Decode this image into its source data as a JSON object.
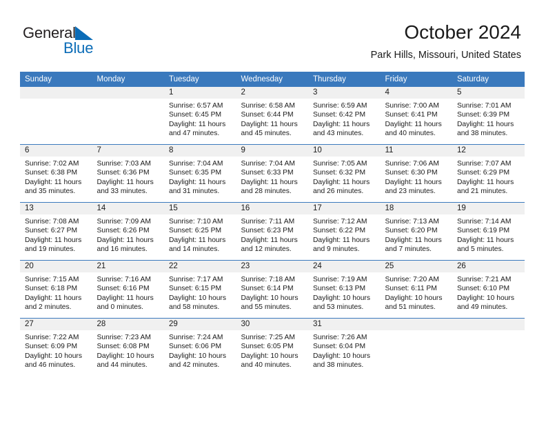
{
  "brand": {
    "name_part1": "General",
    "name_part2": "Blue",
    "triangle_color": "#0b6cb7"
  },
  "header": {
    "title": "October 2024",
    "subtitle": "Park Hills, Missouri, United States"
  },
  "theme": {
    "header_blue": "#3a79bd",
    "band_gray": "#f0f0f0",
    "text": "#1a1a1a"
  },
  "weekdays": [
    "Sunday",
    "Monday",
    "Tuesday",
    "Wednesday",
    "Thursday",
    "Friday",
    "Saturday"
  ],
  "labels": {
    "sunrise_prefix": "Sunrise:",
    "sunset_prefix": "Sunset:",
    "daylight_prefix": "Daylight:"
  },
  "weeks": [
    [
      {
        "day": "",
        "sunrise": "",
        "sunset": "",
        "daylight": ""
      },
      {
        "day": "",
        "sunrise": "",
        "sunset": "",
        "daylight": ""
      },
      {
        "day": "1",
        "sunrise": "Sunrise: 6:57 AM",
        "sunset": "Sunset: 6:45 PM",
        "daylight": "Daylight: 11 hours and 47 minutes."
      },
      {
        "day": "2",
        "sunrise": "Sunrise: 6:58 AM",
        "sunset": "Sunset: 6:44 PM",
        "daylight": "Daylight: 11 hours and 45 minutes."
      },
      {
        "day": "3",
        "sunrise": "Sunrise: 6:59 AM",
        "sunset": "Sunset: 6:42 PM",
        "daylight": "Daylight: 11 hours and 43 minutes."
      },
      {
        "day": "4",
        "sunrise": "Sunrise: 7:00 AM",
        "sunset": "Sunset: 6:41 PM",
        "daylight": "Daylight: 11 hours and 40 minutes."
      },
      {
        "day": "5",
        "sunrise": "Sunrise: 7:01 AM",
        "sunset": "Sunset: 6:39 PM",
        "daylight": "Daylight: 11 hours and 38 minutes."
      }
    ],
    [
      {
        "day": "6",
        "sunrise": "Sunrise: 7:02 AM",
        "sunset": "Sunset: 6:38 PM",
        "daylight": "Daylight: 11 hours and 35 minutes."
      },
      {
        "day": "7",
        "sunrise": "Sunrise: 7:03 AM",
        "sunset": "Sunset: 6:36 PM",
        "daylight": "Daylight: 11 hours and 33 minutes."
      },
      {
        "day": "8",
        "sunrise": "Sunrise: 7:04 AM",
        "sunset": "Sunset: 6:35 PM",
        "daylight": "Daylight: 11 hours and 31 minutes."
      },
      {
        "day": "9",
        "sunrise": "Sunrise: 7:04 AM",
        "sunset": "Sunset: 6:33 PM",
        "daylight": "Daylight: 11 hours and 28 minutes."
      },
      {
        "day": "10",
        "sunrise": "Sunrise: 7:05 AM",
        "sunset": "Sunset: 6:32 PM",
        "daylight": "Daylight: 11 hours and 26 minutes."
      },
      {
        "day": "11",
        "sunrise": "Sunrise: 7:06 AM",
        "sunset": "Sunset: 6:30 PM",
        "daylight": "Daylight: 11 hours and 23 minutes."
      },
      {
        "day": "12",
        "sunrise": "Sunrise: 7:07 AM",
        "sunset": "Sunset: 6:29 PM",
        "daylight": "Daylight: 11 hours and 21 minutes."
      }
    ],
    [
      {
        "day": "13",
        "sunrise": "Sunrise: 7:08 AM",
        "sunset": "Sunset: 6:27 PM",
        "daylight": "Daylight: 11 hours and 19 minutes."
      },
      {
        "day": "14",
        "sunrise": "Sunrise: 7:09 AM",
        "sunset": "Sunset: 6:26 PM",
        "daylight": "Daylight: 11 hours and 16 minutes."
      },
      {
        "day": "15",
        "sunrise": "Sunrise: 7:10 AM",
        "sunset": "Sunset: 6:25 PM",
        "daylight": "Daylight: 11 hours and 14 minutes."
      },
      {
        "day": "16",
        "sunrise": "Sunrise: 7:11 AM",
        "sunset": "Sunset: 6:23 PM",
        "daylight": "Daylight: 11 hours and 12 minutes."
      },
      {
        "day": "17",
        "sunrise": "Sunrise: 7:12 AM",
        "sunset": "Sunset: 6:22 PM",
        "daylight": "Daylight: 11 hours and 9 minutes."
      },
      {
        "day": "18",
        "sunrise": "Sunrise: 7:13 AM",
        "sunset": "Sunset: 6:20 PM",
        "daylight": "Daylight: 11 hours and 7 minutes."
      },
      {
        "day": "19",
        "sunrise": "Sunrise: 7:14 AM",
        "sunset": "Sunset: 6:19 PM",
        "daylight": "Daylight: 11 hours and 5 minutes."
      }
    ],
    [
      {
        "day": "20",
        "sunrise": "Sunrise: 7:15 AM",
        "sunset": "Sunset: 6:18 PM",
        "daylight": "Daylight: 11 hours and 2 minutes."
      },
      {
        "day": "21",
        "sunrise": "Sunrise: 7:16 AM",
        "sunset": "Sunset: 6:16 PM",
        "daylight": "Daylight: 11 hours and 0 minutes."
      },
      {
        "day": "22",
        "sunrise": "Sunrise: 7:17 AM",
        "sunset": "Sunset: 6:15 PM",
        "daylight": "Daylight: 10 hours and 58 minutes."
      },
      {
        "day": "23",
        "sunrise": "Sunrise: 7:18 AM",
        "sunset": "Sunset: 6:14 PM",
        "daylight": "Daylight: 10 hours and 55 minutes."
      },
      {
        "day": "24",
        "sunrise": "Sunrise: 7:19 AM",
        "sunset": "Sunset: 6:13 PM",
        "daylight": "Daylight: 10 hours and 53 minutes."
      },
      {
        "day": "25",
        "sunrise": "Sunrise: 7:20 AM",
        "sunset": "Sunset: 6:11 PM",
        "daylight": "Daylight: 10 hours and 51 minutes."
      },
      {
        "day": "26",
        "sunrise": "Sunrise: 7:21 AM",
        "sunset": "Sunset: 6:10 PM",
        "daylight": "Daylight: 10 hours and 49 minutes."
      }
    ],
    [
      {
        "day": "27",
        "sunrise": "Sunrise: 7:22 AM",
        "sunset": "Sunset: 6:09 PM",
        "daylight": "Daylight: 10 hours and 46 minutes."
      },
      {
        "day": "28",
        "sunrise": "Sunrise: 7:23 AM",
        "sunset": "Sunset: 6:08 PM",
        "daylight": "Daylight: 10 hours and 44 minutes."
      },
      {
        "day": "29",
        "sunrise": "Sunrise: 7:24 AM",
        "sunset": "Sunset: 6:06 PM",
        "daylight": "Daylight: 10 hours and 42 minutes."
      },
      {
        "day": "30",
        "sunrise": "Sunrise: 7:25 AM",
        "sunset": "Sunset: 6:05 PM",
        "daylight": "Daylight: 10 hours and 40 minutes."
      },
      {
        "day": "31",
        "sunrise": "Sunrise: 7:26 AM",
        "sunset": "Sunset: 6:04 PM",
        "daylight": "Daylight: 10 hours and 38 minutes."
      },
      {
        "day": "",
        "sunrise": "",
        "sunset": "",
        "daylight": ""
      },
      {
        "day": "",
        "sunrise": "",
        "sunset": "",
        "daylight": ""
      }
    ]
  ]
}
